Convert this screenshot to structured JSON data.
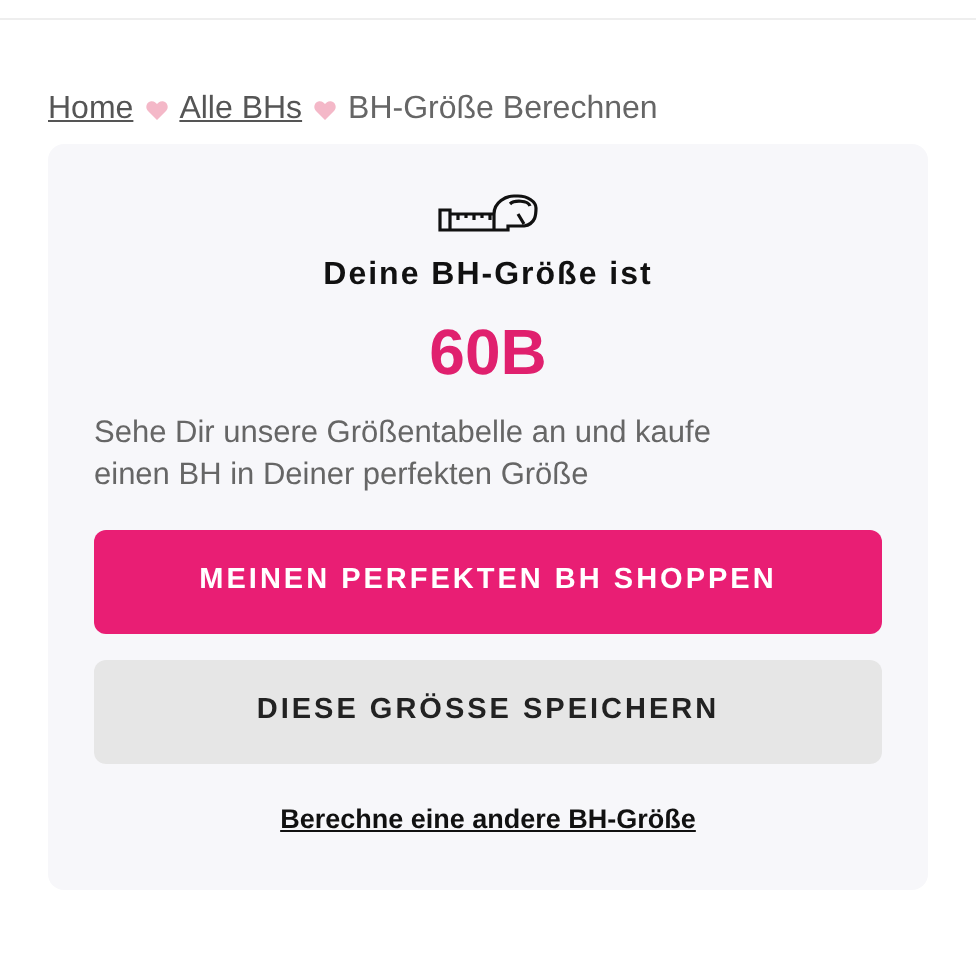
{
  "breadcrumb": [
    {
      "label": "Home",
      "kind": "link"
    },
    {
      "label": "Alle BHs",
      "kind": "link"
    },
    {
      "label": "BH-Größe Berechnen",
      "kind": "current"
    }
  ],
  "result": {
    "heading": "Deine BH-Größe ist",
    "size": "60B",
    "description": "Sehe Dir unsere Größentabelle an und kaufe einen BH in Deiner perfekten Größe"
  },
  "buttons": [
    {
      "label": "MEINEN PERFEKTEN BH SHOPPEN",
      "kind": "primary"
    },
    {
      "label": "DIESE GRÖSSE SPEICHERN",
      "kind": "secondary"
    }
  ],
  "link": "Berechne eine andere BH-Größe"
}
